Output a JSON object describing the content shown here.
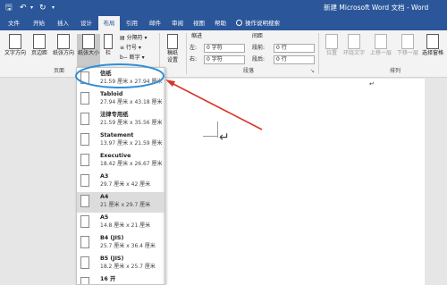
{
  "titlebar": {
    "save_icon": "save-icon",
    "undo_icon": "undo-icon",
    "redo_icon": "redo-icon",
    "title": "新建 Microsoft Word 文档 - Word"
  },
  "tabs": [
    "文件",
    "开始",
    "插入",
    "设计",
    "布局",
    "引用",
    "邮件",
    "审阅",
    "视图",
    "帮助",
    "操作说明搜索"
  ],
  "active_tab": "布局",
  "ribbon": {
    "text_direction": "文字方向",
    "margins": "页边距",
    "orientation": "纸张方向",
    "size": "纸张大小",
    "columns": "栏",
    "breaks": "分隔符",
    "line_numbers": "行号",
    "hyphenation": "断字",
    "manuscript_line1": "稿纸",
    "manuscript_line2": "设置",
    "indent_label": "缩进",
    "spacing_label": "间距",
    "indent_left_label": "左:",
    "indent_right_label": "右:",
    "indent_left_value": "0 字符",
    "indent_right_value": "0 字符",
    "spacing_before_label": "段前:",
    "spacing_after_label": "段后:",
    "spacing_before_value": "0 行",
    "spacing_after_value": "0 行",
    "group_page_setup": "页面",
    "group_paragraph": "段落",
    "group_arrange": "排列",
    "position": "位置",
    "wrap_text": "环绕文字",
    "bring_forward": "上移一层",
    "send_backward": "下移一层",
    "selection_pane": "选择窗格"
  },
  "paper_sizes": [
    {
      "name": "信纸",
      "size": "21.59 厘米 x 27.94 厘米"
    },
    {
      "name": "Tabloid",
      "size": "27.94 厘米 x 43.18 厘米"
    },
    {
      "name": "法律专用纸",
      "size": "21.59 厘米 x 35.56 厘米"
    },
    {
      "name": "Statement",
      "size": "13.97 厘米 x 21.59 厘米"
    },
    {
      "name": "Executive",
      "size": "18.42 厘米 x 26.67 厘米"
    },
    {
      "name": "A3",
      "size": "29.7 厘米 x 42 厘米"
    },
    {
      "name": "A4",
      "size": "21 厘米 x 29.7 厘米"
    },
    {
      "name": "A5",
      "size": "14.8 厘米 x 21 厘米"
    },
    {
      "name": "B4 (JIS)",
      "size": "25.7 厘米 x 36.4 厘米"
    },
    {
      "name": "B5 (JIS)",
      "size": "18.2 厘米 x 25.7 厘米"
    },
    {
      "name": "16 开",
      "size": ""
    }
  ],
  "selected_paper": "A4",
  "colors": {
    "accent": "#2b579a",
    "highlight_circle": "#2e8fd6",
    "annotation_arrow": "#d9352b"
  }
}
